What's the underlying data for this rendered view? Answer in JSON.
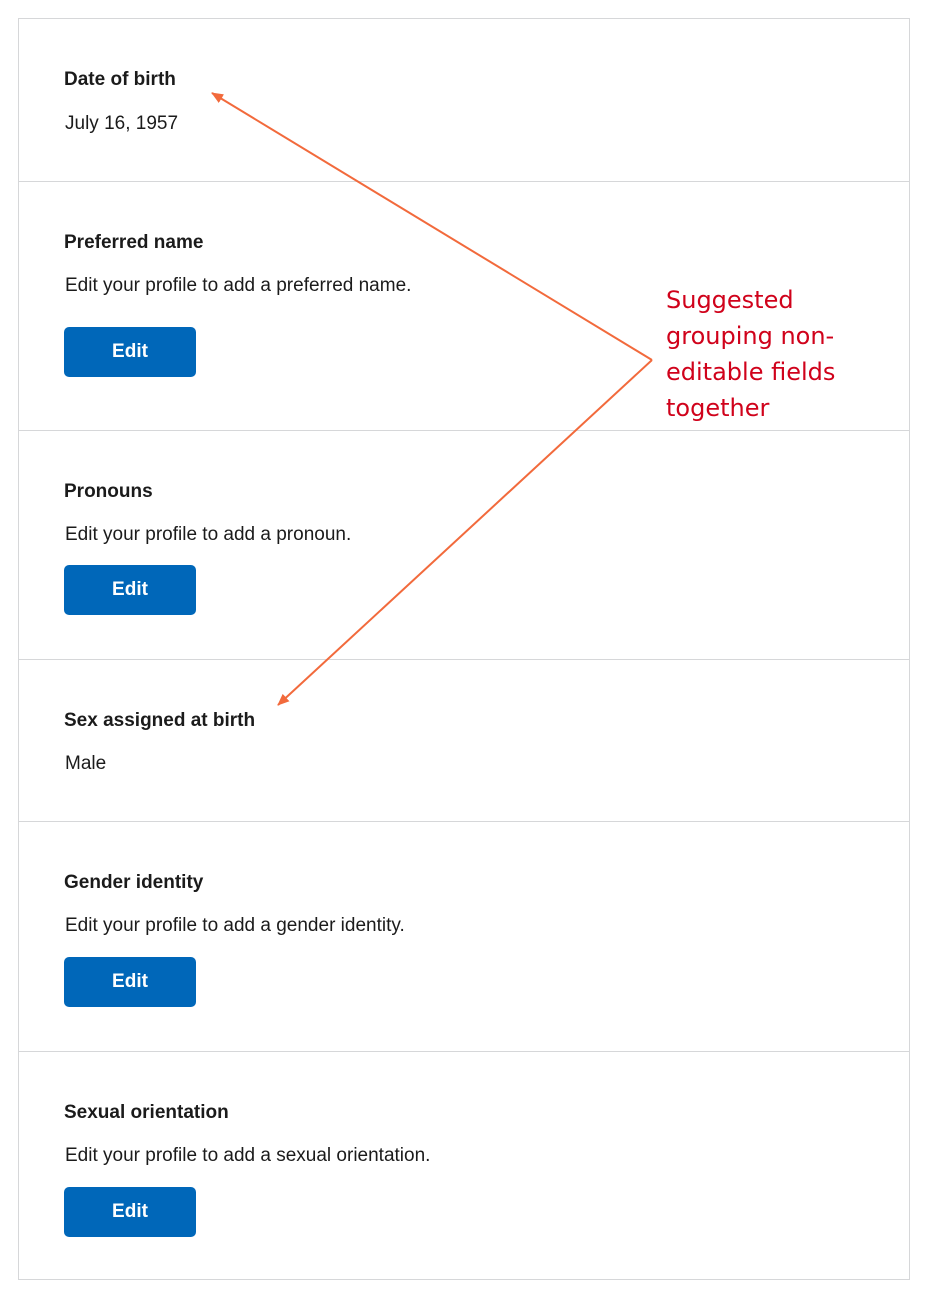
{
  "fields": [
    {
      "label": "Date of birth",
      "value": "July 16, 1957"
    },
    {
      "label": "Preferred name",
      "value": "Edit your profile to add a preferred name.",
      "button": "Edit"
    },
    {
      "label": "Pronouns",
      "value": "Edit your profile to add a pronoun.",
      "button": "Edit"
    },
    {
      "label": "Sex assigned at birth",
      "value": "Male"
    },
    {
      "label": "Gender identity",
      "value": "Edit your profile to add a gender identity.",
      "button": "Edit"
    },
    {
      "label": "Sexual orientation",
      "value": "Edit your profile to add a sexual orientation.",
      "button": "Edit"
    }
  ],
  "annotation": {
    "text": "Suggested grouping non-editable fields together",
    "color": "#d0021b",
    "arrow_color": "#f26a3c"
  },
  "colors": {
    "button": "#0067b9",
    "border": "#d6d7d9"
  }
}
